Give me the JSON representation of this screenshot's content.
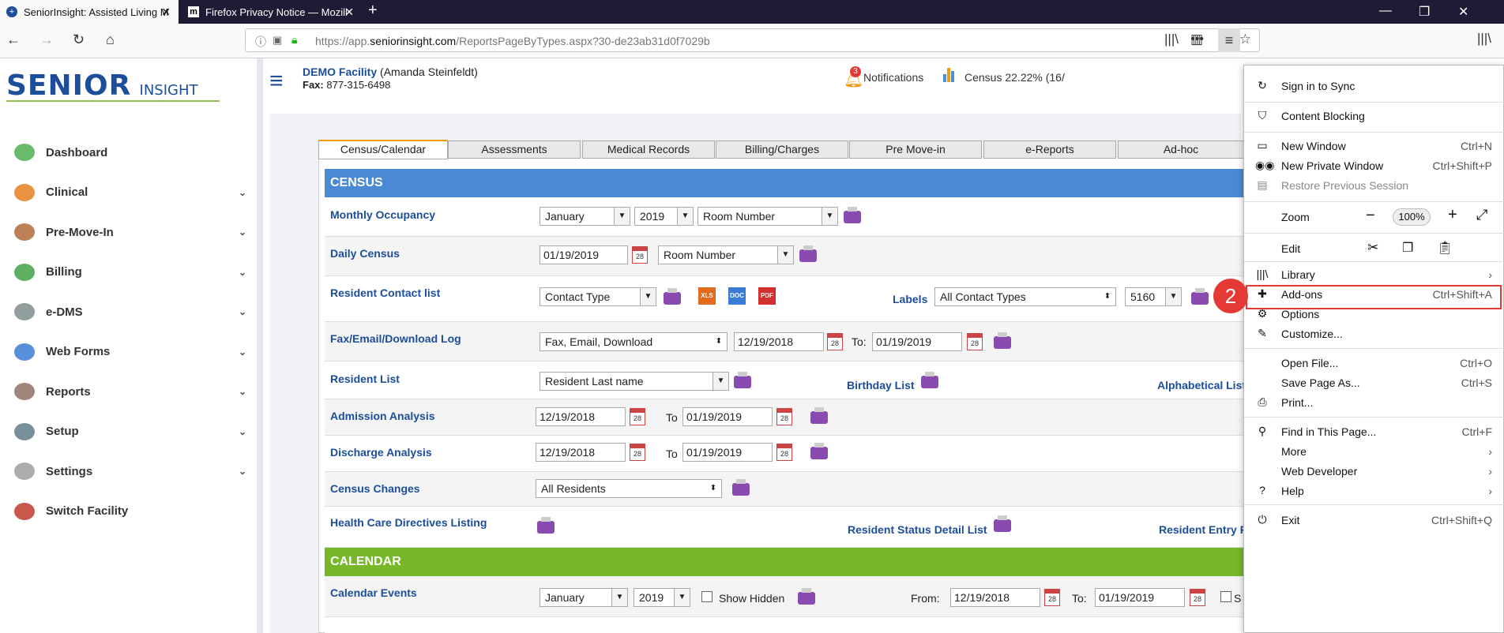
{
  "browser": {
    "tabs": [
      {
        "title": "SeniorInsight: Assisted Living M"
      },
      {
        "title": "Firefox Privacy Notice — Mozill"
      }
    ],
    "url_prefix": "https://app.",
    "url_domain": "seniorinsight.com",
    "url_path": "/ReportsPageByTypes.aspx?30-de23ab31d0f7029b"
  },
  "logo": {
    "brand": "SENIOR",
    "suffix": "INSIGHT"
  },
  "sidebar": {
    "items": [
      {
        "label": "Dashboard",
        "icon": "dashboard-icon",
        "expandable": false
      },
      {
        "label": "Clinical",
        "icon": "clinical-icon",
        "expandable": true
      },
      {
        "label": "Pre-Move-In",
        "icon": "bed-icon",
        "expandable": true
      },
      {
        "label": "Billing",
        "icon": "dollar-icon",
        "expandable": true
      },
      {
        "label": "e-DMS",
        "icon": "documents-icon",
        "expandable": true
      },
      {
        "label": "Web Forms",
        "icon": "monitor-icon",
        "expandable": true
      },
      {
        "label": "Reports",
        "icon": "reports-icon",
        "expandable": true
      },
      {
        "label": "Setup",
        "icon": "wrench-icon",
        "expandable": true
      },
      {
        "label": "Settings",
        "icon": "gear-icon",
        "expandable": true
      },
      {
        "label": "Switch Facility",
        "icon": "signpost-icon",
        "expandable": false
      }
    ]
  },
  "header": {
    "facility": "DEMO Facility",
    "user": "(Amanda Steinfeldt)",
    "fax_label": "Fax:",
    "fax": "877-315-6498",
    "notif_count": "3",
    "notifications": "Notifications",
    "census": "Census 22.22% (16/"
  },
  "tabs": [
    "Census/Calendar",
    "Assessments",
    "Medical Records",
    "Billing/Charges",
    "Pre Move-in",
    "e-Reports",
    "Ad-hoc"
  ],
  "census": {
    "title": "CENSUS",
    "monthly": {
      "label": "Monthly Occupancy",
      "month": "January",
      "year": "2019",
      "sort": "Room Number"
    },
    "daily": {
      "label": "Daily Census",
      "date": "01/19/2019",
      "sort": "Room Number"
    },
    "contact": {
      "label": "Resident Contact list",
      "type": "Contact Type",
      "labels_label": "Labels",
      "labels_value": "All Contact Types",
      "labels_size": "5160",
      "xls": "XLS",
      "doc": "DOC",
      "pdf": "PDF"
    },
    "fax": {
      "label": "Fax/Email/Download Log",
      "type": "Fax, Email, Download",
      "from": "12/19/2018",
      "to_label": "To:",
      "to": "01/19/2019"
    },
    "reslist": {
      "label": "Resident List",
      "sort": "Resident Last name",
      "birthday": "Birthday List",
      "alpha": "Alphabetical List"
    },
    "admission": {
      "label": "Admission Analysis",
      "from": "12/19/2018",
      "to_label": "To",
      "to": "01/19/2019"
    },
    "discharge": {
      "label": "Discharge Analysis",
      "from": "12/19/2018",
      "to_label": "To",
      "to": "01/19/2019"
    },
    "changes": {
      "label": "Census Changes",
      "residents": "All Residents"
    },
    "hcd": {
      "label": "Health Care Directives Listing",
      "status": "Resident Status Detail List",
      "entry": "Resident Entry F"
    }
  },
  "calendar": {
    "title": "CALENDAR",
    "events": {
      "label": "Calendar Events",
      "month": "January",
      "year": "2019",
      "hidden": "Show Hidden",
      "from_label": "From:",
      "from": "12/19/2018",
      "to_label": "To:",
      "to": "01/19/2019",
      "s": "S"
    }
  },
  "ffmenu": {
    "sync": "Sign in to Sync",
    "blocking": "Content Blocking",
    "newwin": "New Window",
    "newwin_key": "Ctrl+N",
    "private": "New Private Window",
    "private_key": "Ctrl+Shift+P",
    "restore": "Restore Previous Session",
    "zoom": "Zoom",
    "zoom_value": "100%",
    "edit": "Edit",
    "library": "Library",
    "addons": "Add-ons",
    "addons_key": "Ctrl+Shift+A",
    "options": "Options",
    "customize": "Customize...",
    "openfile": "Open File...",
    "openfile_key": "Ctrl+O",
    "savepage": "Save Page As...",
    "savepage_key": "Ctrl+S",
    "print": "Print...",
    "find": "Find in This Page...",
    "find_key": "Ctrl+F",
    "more": "More",
    "webdev": "Web Developer",
    "help": "Help",
    "exit": "Exit",
    "exit_key": "Ctrl+Shift+Q"
  },
  "annotation": {
    "step": "2",
    "color": "#e53935"
  }
}
